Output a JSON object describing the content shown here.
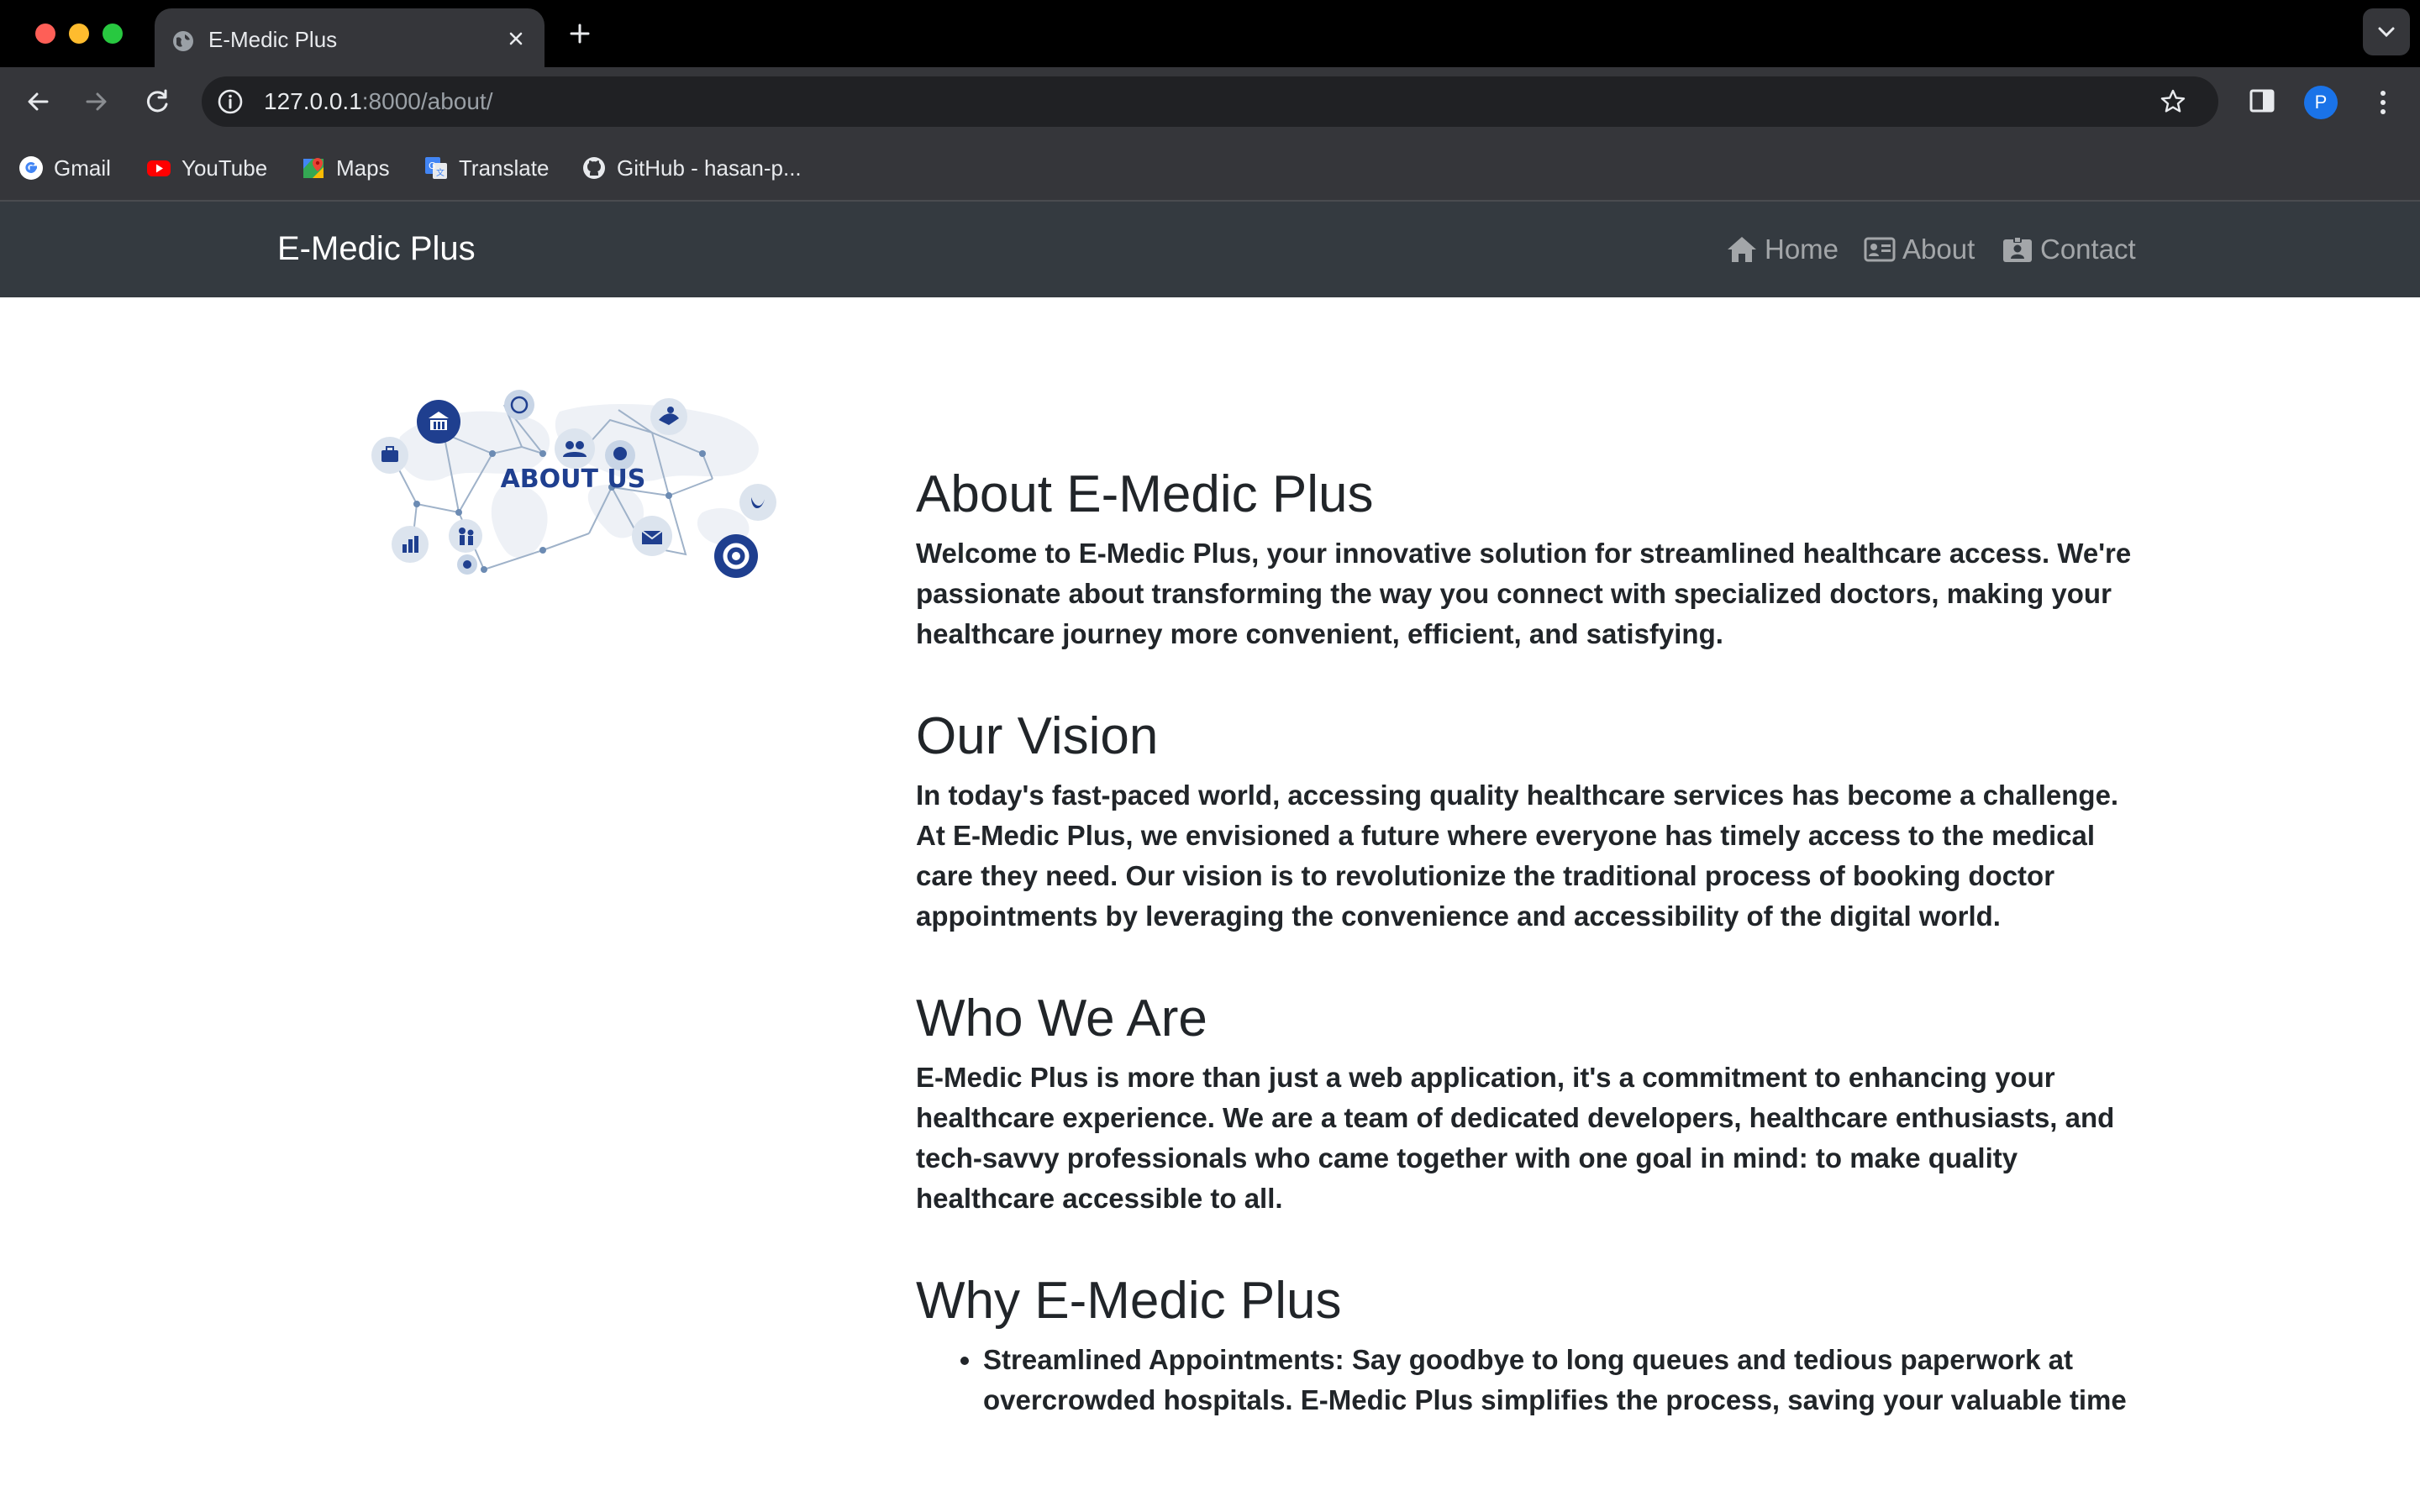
{
  "browser": {
    "tab_title": "E-Medic Plus",
    "url_host": "127.0.0.1",
    "url_rest": ":8000/about/",
    "profile_initial": "P",
    "bookmarks": [
      {
        "label": "Gmail",
        "icon": "gmail-icon"
      },
      {
        "label": "YouTube",
        "icon": "youtube-icon"
      },
      {
        "label": "Maps",
        "icon": "maps-icon"
      },
      {
        "label": "Translate",
        "icon": "translate-icon"
      },
      {
        "label": "GitHub - hasan-p...",
        "icon": "github-icon"
      }
    ]
  },
  "navbar": {
    "brand": "E-Medic Plus",
    "links": [
      {
        "label": "Home",
        "icon": "home-icon"
      },
      {
        "label": "About",
        "icon": "id-card-icon"
      },
      {
        "label": "Contact",
        "icon": "contact-card-icon"
      }
    ]
  },
  "hero_image": {
    "label": "ABOUT US",
    "accent": "#1f3f8f"
  },
  "sections": [
    {
      "heading": "About E-Medic Plus",
      "body": "Welcome to E-Medic Plus, your innovative solution for streamlined healthcare access. We're passionate about transforming the way you connect with specialized doctors, making your healthcare journey more convenient, efficient, and satisfying."
    },
    {
      "heading": "Our Vision",
      "body": "In today's fast-paced world, accessing quality healthcare services has become a challenge. At E-Medic Plus, we envisioned a future where everyone has timely access to the medical care they need. Our vision is to revolutionize the traditional process of booking doctor appointments by leveraging the convenience and accessibility of the digital world."
    },
    {
      "heading": "Who We Are",
      "body": "E-Medic Plus is more than just a web application, it's a commitment to enhancing your healthcare experience. We are a team of dedicated developers, healthcare enthusiasts, and tech-savvy professionals who came together with one goal in mind: to make quality healthcare accessible to all."
    },
    {
      "heading": "Why E-Medic Plus",
      "items": [
        {
          "title": "Streamlined Appointments:",
          "text": " Say goodbye to long queues and tedious paperwork at overcrowded hospitals. E-Medic Plus simplifies the process, saving your valuable time"
        }
      ]
    }
  ],
  "colors": {
    "navbar_bg": "#343a40",
    "text": "#212529",
    "nav_link": "rgba(255,255,255,0.55)"
  }
}
